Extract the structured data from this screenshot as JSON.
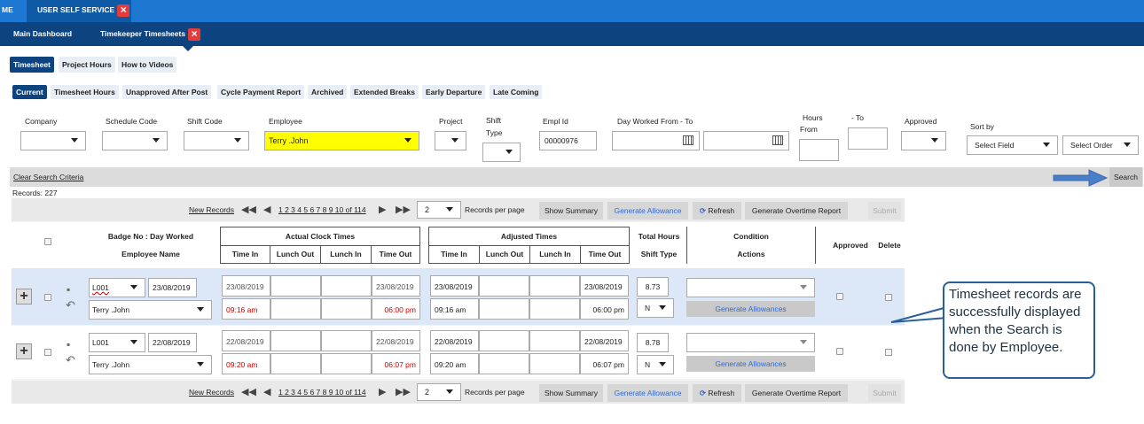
{
  "top_tabs": {
    "home": "ME",
    "uss": "USER SELF SERVICE"
  },
  "sub_tabs": {
    "dashboard": "Main Dashboard",
    "timekeeper": "Timekeeper Timesheets"
  },
  "main_tabs": [
    "Timesheet",
    "Project Hours",
    "How to Videos"
  ],
  "sub_filters": [
    "Current",
    "Timesheet Hours",
    "Unapproved After Post",
    "Cycle Payment Report",
    "Archived",
    "Extended Breaks",
    "Early Departure",
    "Late Coming"
  ],
  "filters": {
    "company": "Company",
    "schedule_code": "Schedule Code",
    "shift_code": "Shift Code",
    "employee": "Employee",
    "employee_value": "Terry .John",
    "project": "Project",
    "shift_type_1": "Shift",
    "shift_type_2": "Type",
    "empl_id": "Empl Id",
    "empl_id_value": "00000976",
    "day_worked": "Day Worked From - To",
    "hours_1": "Hours",
    "hours_2": "From",
    "to": "- To",
    "approved": "Approved",
    "sort_by": "Sort by",
    "select_field": "Select Field",
    "select_order": "Select Order"
  },
  "clear_search": "Clear Search Criteria",
  "search_btn": "Search",
  "records": "Records:  227",
  "pager": {
    "new_records": "New Records",
    "pages": "1 2 3 4 5 6 7 8 9 10 of 114",
    "per_page_value": "2",
    "per_page": "Records per page",
    "show_summary": "Show Summary",
    "gen_allowance": "Generate Allowance",
    "refresh": "Refresh",
    "gen_ot": "Generate Overtime Report",
    "submit": "Submit"
  },
  "headers": {
    "badge": "Badge No : Day Worked",
    "emp_name": "Employee Name",
    "actual": "Actual Clock Times",
    "adjusted": "Adjusted Times",
    "time_in": "Time In",
    "lunch_out": "Lunch Out",
    "lunch_in": "Lunch In",
    "time_out": "Time Out",
    "total_hours": "Total Hours",
    "shift_type": "Shift Type",
    "condition": "Condition",
    "actions": "Actions",
    "approved": "Approved",
    "delete": "Delete"
  },
  "rows": [
    {
      "badge": "L001",
      "date": "23/08/2019",
      "name": "Terry .John",
      "act_in_date": "23/08/2019",
      "act_out_date": "23/08/2019",
      "act_in": "09:16 am",
      "act_out": "06:00 pm",
      "adj_in_date": "23/08/2019",
      "adj_out_date": "23/08/2019",
      "adj_in": "09:16 am",
      "adj_out": "06:00 pm",
      "hours": "8.73",
      "shift": "N",
      "gen": "Generate Allowances"
    },
    {
      "badge": "L001",
      "date": "22/08/2019",
      "name": "Terry .John",
      "act_in_date": "22/08/2019",
      "act_out_date": "22/08/2019",
      "act_in": "09:20 am",
      "act_out": "06:07 pm",
      "adj_in_date": "22/08/2019",
      "adj_out_date": "22/08/2019",
      "adj_in": "09:20 am",
      "adj_out": "06:07 pm",
      "hours": "8.78",
      "shift": "N",
      "gen": "Generate Allowances"
    }
  ],
  "callout": "Timesheet records are successfully displayed when the Search is done by Employee.",
  "colors": {
    "topbar": "#1e78d2",
    "subbar": "#0d4480",
    "highlight": "#ffff00",
    "selected_row": "#dce7f8"
  }
}
